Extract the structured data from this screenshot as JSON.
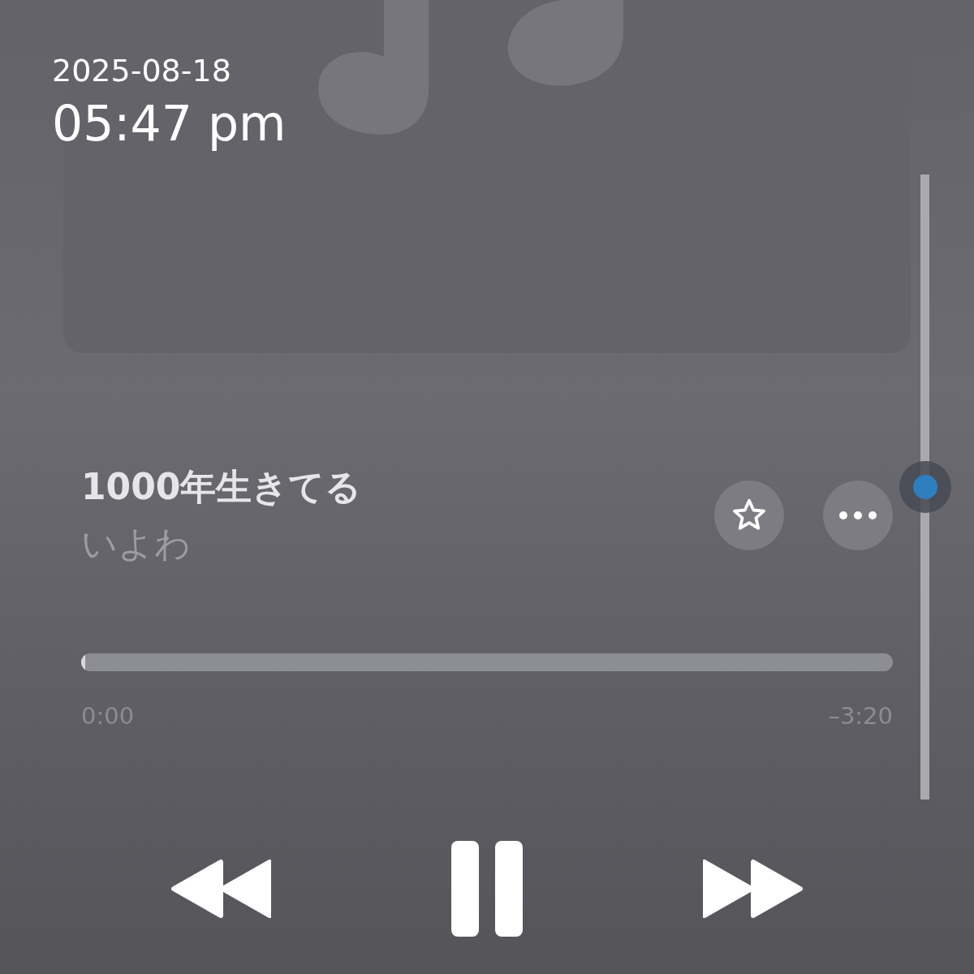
{
  "timestamp": {
    "date": "2025-08-18",
    "time": "05:47 pm"
  },
  "track": {
    "title": "1000年生きてる",
    "artist": "いよわ"
  },
  "actions": [
    {
      "kind": "favorite"
    },
    {
      "kind": "more"
    }
  ],
  "progress": {
    "level": 0.005,
    "elapsed": "0:00",
    "remaining": "–3:20"
  },
  "volume": {
    "level": 0.5
  },
  "controls": [
    {
      "kind": "rewind"
    },
    {
      "kind": "pause"
    },
    {
      "kind": "forward"
    }
  ]
}
